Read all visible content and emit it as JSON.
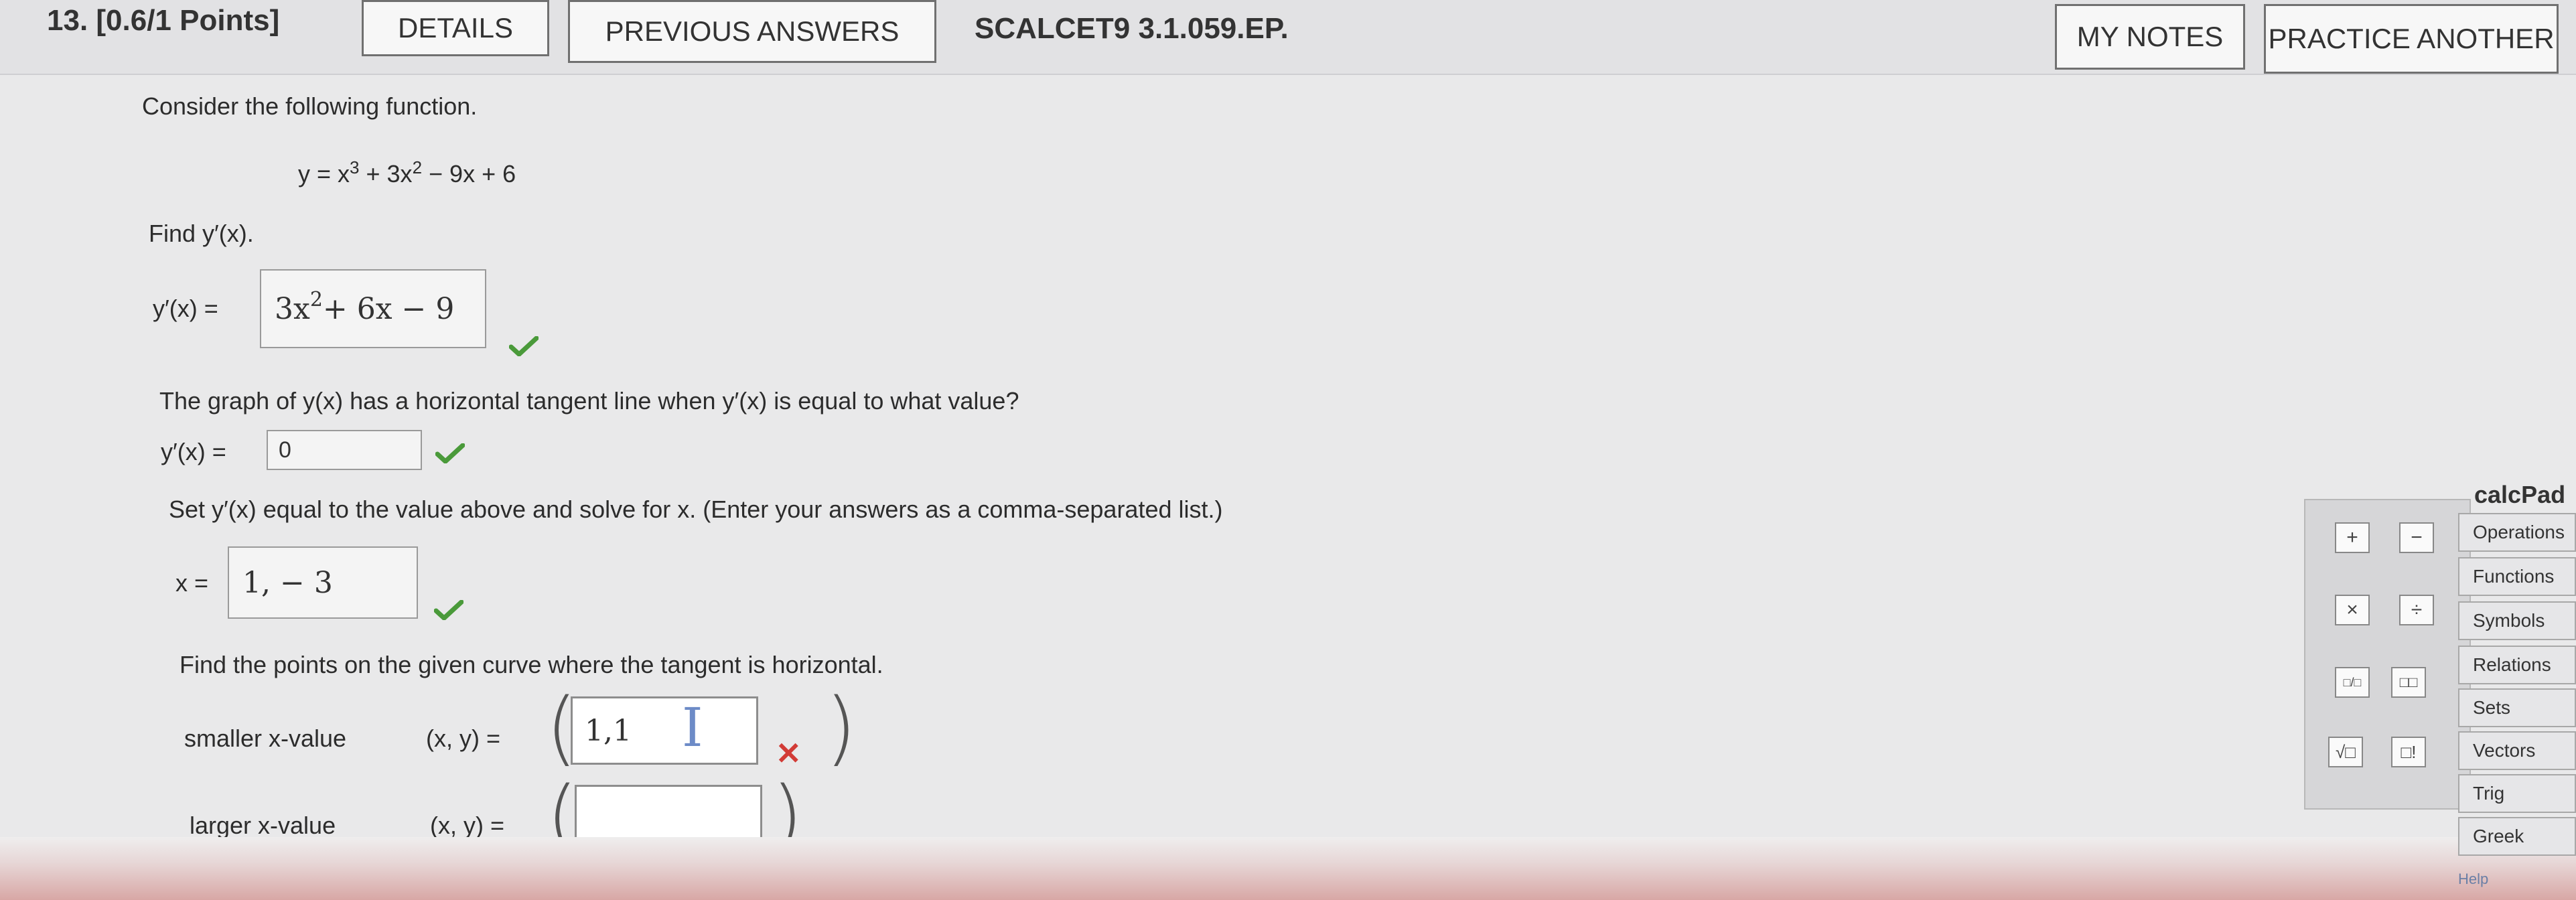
{
  "header": {
    "question_label": "13. [0.6/1 Points]",
    "details_label": "DETAILS",
    "previous_answers_label": "PREVIOUS ANSWERS",
    "problem_code": "SCALCET9 3.1.059.EP.",
    "my_notes_label": "MY NOTES",
    "practice_another_label": "PRACTICE ANOTHER"
  },
  "problem": {
    "intro": "Consider the following function.",
    "function": {
      "lhs": "y = x",
      "exp1": "3",
      "mid": " + 3x",
      "exp2": "2",
      "rhs": " − 9x + 6"
    },
    "find": "Find y′(x).",
    "deriv_label": "y′(x) =",
    "deriv_answer": {
      "base": "3x",
      "exp": "2",
      "rest": " + 6x − 9"
    },
    "horizontal_q": "The graph of y(x) has a horizontal tangent line when y′(x) is equal to what value?",
    "yprime_label": "y′(x) =",
    "yprime_value": "0",
    "set_instruction": "Set y′(x) equal to the value above and solve for x. (Enter your answers as a comma-separated list.)",
    "x_label": "x =",
    "x_answer": "1, − 3",
    "find_points": "Find the points on the given curve where the tangent is horizontal.",
    "smaller_label": "smaller x-value",
    "larger_label": "larger x-value",
    "xy_label": "(x, y) =",
    "smaller_value": "1,1",
    "larger_value": ""
  },
  "calcpad": {
    "title": "calcPad",
    "buttons": [
      "+",
      "−",
      "×",
      "÷",
      "□/□",
      "□□",
      "√□",
      "□!"
    ],
    "categories": [
      "Operations",
      "Functions",
      "Symbols",
      "Relations",
      "Sets",
      "Vectors",
      "Trig",
      "Greek"
    ],
    "help": "Help"
  },
  "colors": {
    "correct": "#4a9a3a",
    "incorrect": "#d23b36"
  }
}
